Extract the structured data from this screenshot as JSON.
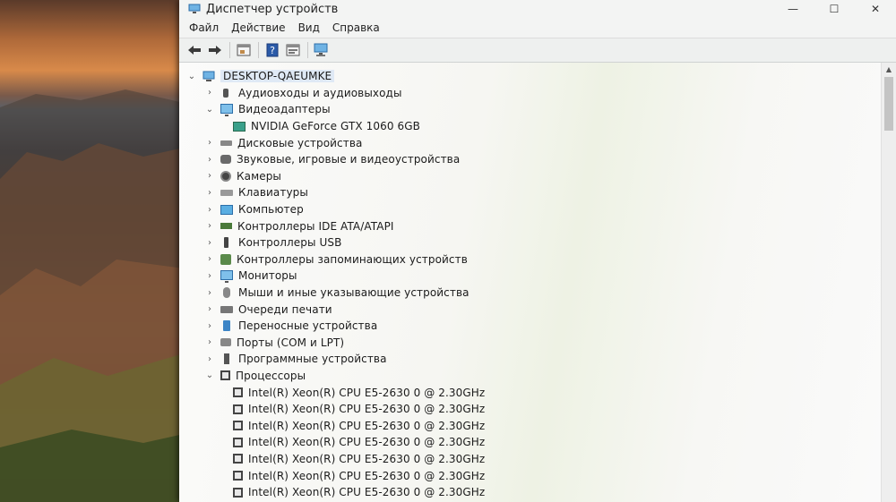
{
  "window": {
    "title": "Диспетчер устройств",
    "controls": {
      "minimize": "—",
      "maximize": "☐",
      "close": "✕"
    }
  },
  "menu": [
    "Файл",
    "Действие",
    "Вид",
    "Справка"
  ],
  "toolbar": {
    "back_icon": "arrow-left-icon",
    "forward_icon": "arrow-right-icon",
    "properties_icon": "properties-icon",
    "help_icon": "help-icon",
    "view_icon": "view-icon",
    "scan_icon": "scan-hardware-icon"
  },
  "tree": {
    "root": "DESKTOP-QAEUMKE",
    "categories": [
      {
        "label": "Аудиовходы и аудиовыходы",
        "icon": "speaker-icon",
        "expanded": false,
        "children": []
      },
      {
        "label": "Видеоадаптеры",
        "icon": "display-adapter-icon",
        "expanded": true,
        "children": [
          "NVIDIA GeForce GTX 1060 6GB"
        ]
      },
      {
        "label": "Дисковые устройства",
        "icon": "disk-icon",
        "expanded": false,
        "children": []
      },
      {
        "label": "Звуковые, игровые и видеоустройства",
        "icon": "sound-icon",
        "expanded": false,
        "children": []
      },
      {
        "label": "Камеры",
        "icon": "camera-icon",
        "expanded": false,
        "children": []
      },
      {
        "label": "Клавиатуры",
        "icon": "keyboard-icon",
        "expanded": false,
        "children": []
      },
      {
        "label": "Компьютер",
        "icon": "computer-icon",
        "expanded": false,
        "children": []
      },
      {
        "label": "Контроллеры IDE ATA/ATAPI",
        "icon": "ide-controller-icon",
        "expanded": false,
        "children": []
      },
      {
        "label": "Контроллеры USB",
        "icon": "usb-icon",
        "expanded": false,
        "children": []
      },
      {
        "label": "Контроллеры запоминающих устройств",
        "icon": "storage-controller-icon",
        "expanded": false,
        "children": []
      },
      {
        "label": "Мониторы",
        "icon": "monitor-icon",
        "expanded": false,
        "children": []
      },
      {
        "label": "Мыши и иные указывающие устройства",
        "icon": "mouse-icon",
        "expanded": false,
        "children": []
      },
      {
        "label": "Очереди печати",
        "icon": "printer-icon",
        "expanded": false,
        "children": []
      },
      {
        "label": "Переносные устройства",
        "icon": "portable-device-icon",
        "expanded": false,
        "children": []
      },
      {
        "label": "Порты (COM и LPT)",
        "icon": "ports-icon",
        "expanded": false,
        "children": []
      },
      {
        "label": "Программные устройства",
        "icon": "software-device-icon",
        "expanded": false,
        "children": []
      },
      {
        "label": "Процессоры",
        "icon": "cpu-icon",
        "expanded": true,
        "children": [
          "Intel(R) Xeon(R) CPU E5-2630 0 @ 2.30GHz",
          "Intel(R) Xeon(R) CPU E5-2630 0 @ 2.30GHz",
          "Intel(R) Xeon(R) CPU E5-2630 0 @ 2.30GHz",
          "Intel(R) Xeon(R) CPU E5-2630 0 @ 2.30GHz",
          "Intel(R) Xeon(R) CPU E5-2630 0 @ 2.30GHz",
          "Intel(R) Xeon(R) CPU E5-2630 0 @ 2.30GHz",
          "Intel(R) Xeon(R) CPU E5-2630 0 @ 2.30GHz"
        ]
      }
    ]
  }
}
